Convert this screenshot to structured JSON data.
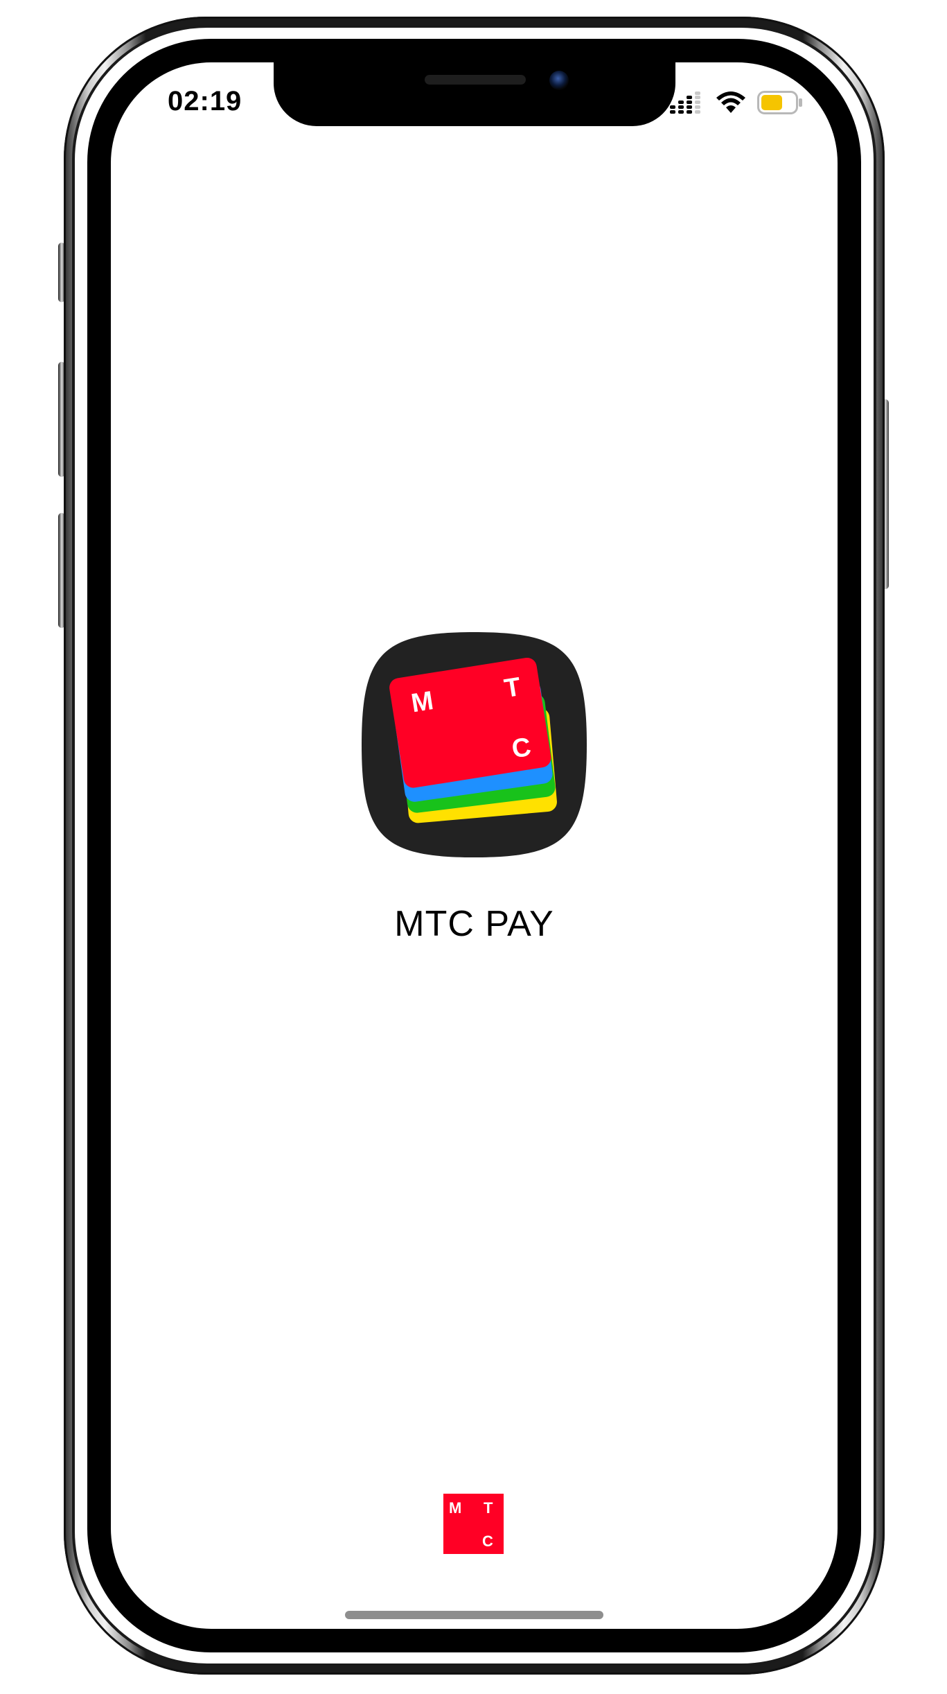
{
  "status_bar": {
    "time": "02:19",
    "icons": [
      "cellular-signal-icon",
      "wifi-icon",
      "battery-icon"
    ],
    "battery_color": "#f5c400"
  },
  "splash": {
    "app_name": "MTC PAY",
    "app_icon": {
      "name": "mts-pay-app-icon",
      "letters": [
        "M",
        "T",
        "C"
      ],
      "card_colors": [
        "#ff0025",
        "#1e90ff",
        "#18c21b",
        "#ffe100"
      ],
      "background": "#222222"
    }
  },
  "footer": {
    "brand_logo": {
      "name": "mts-brand-logo",
      "letters": [
        "M",
        "T",
        "C"
      ],
      "color": "#ff0025"
    }
  }
}
